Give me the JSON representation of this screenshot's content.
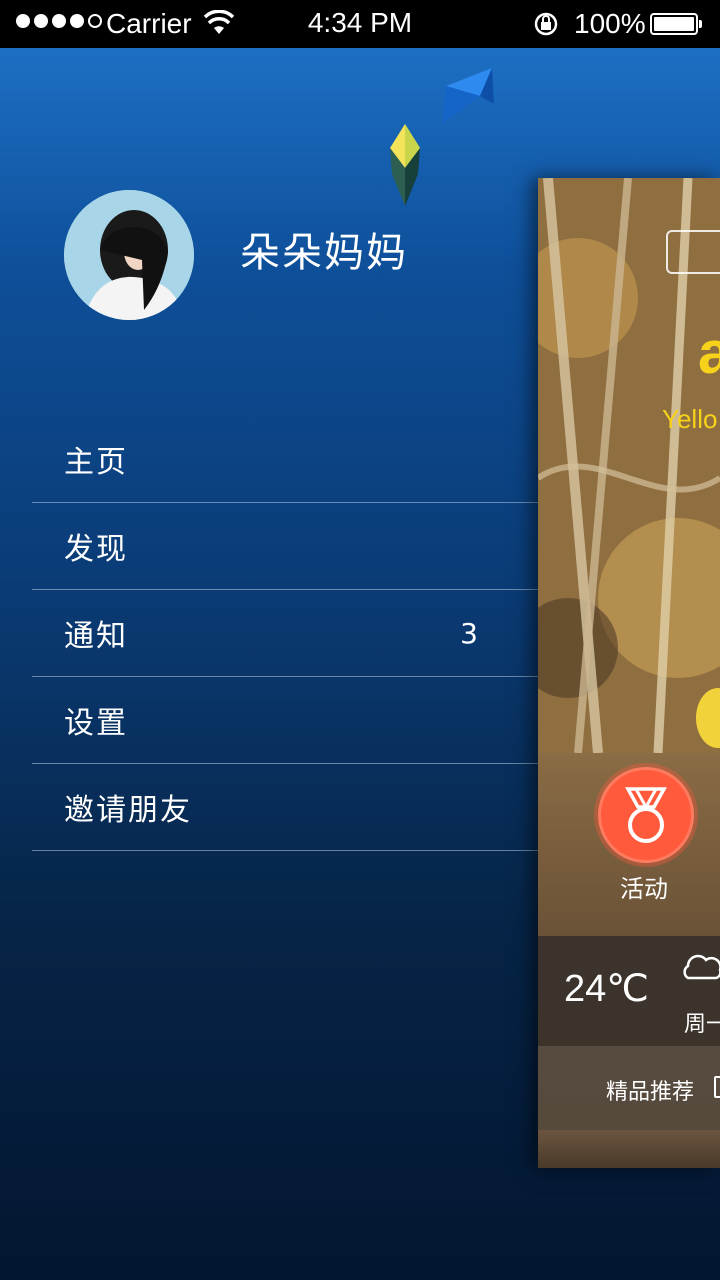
{
  "status_bar": {
    "carrier": "Carrier",
    "time": "4:34 PM",
    "battery_percent": "100%",
    "signal_bars_filled": 4,
    "signal_bars_total": 5
  },
  "user": {
    "name": "朵朵妈妈"
  },
  "menu": {
    "items": [
      {
        "label": "主页",
        "badge": ""
      },
      {
        "label": "发现",
        "badge": ""
      },
      {
        "label": "通知",
        "badge": "3"
      },
      {
        "label": "设置",
        "badge": ""
      },
      {
        "label": "邀请朋友",
        "badge": ""
      }
    ]
  },
  "main_panel": {
    "logo_letter": "a",
    "logo_sub": "Yello",
    "activity_label": "活动",
    "weather": {
      "temperature": "24℃",
      "weekday": "周一"
    },
    "recommend_label": "精品推荐"
  },
  "colors": {
    "accent_orange": "#ff5a3c",
    "logo_yellow": "#f7d21a",
    "menu_top": "#1d6fc4",
    "menu_bottom": "#031630"
  },
  "icons": [
    "wifi-icon",
    "rotation-lock-icon",
    "battery-icon",
    "medal-icon",
    "cloud-icon",
    "calendar-icon"
  ]
}
